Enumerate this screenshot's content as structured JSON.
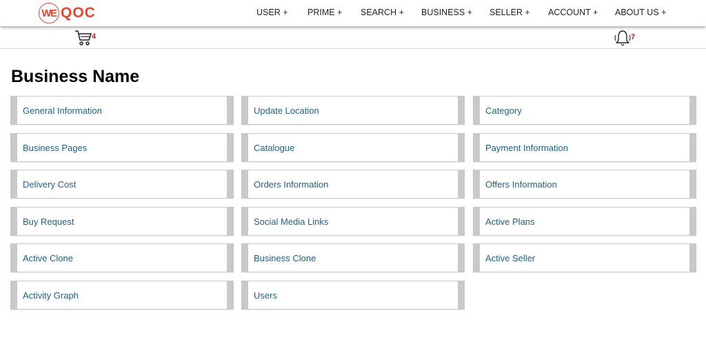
{
  "brand": {
    "logo_mark": "WE",
    "logo_text": "QOC"
  },
  "nav": {
    "items": [
      {
        "id": "user",
        "label": "USER +"
      },
      {
        "id": "prime",
        "label": "PRIME +"
      },
      {
        "id": "search",
        "label": "SEARCH +"
      },
      {
        "id": "business",
        "label": "BUSINESS +"
      },
      {
        "id": "seller",
        "label": "SELLER +"
      },
      {
        "id": "account",
        "label": "ACCOUNT +"
      },
      {
        "id": "about",
        "label": "ABOUT US +"
      }
    ]
  },
  "toolbar": {
    "cart": {
      "icon": "cart-icon",
      "count": "4"
    },
    "notifications": {
      "icon": "bell-icon",
      "count": "7"
    }
  },
  "page": {
    "title": "Business Name"
  },
  "menu": {
    "cards": [
      {
        "label": "General Information"
      },
      {
        "label": "Update Location"
      },
      {
        "label": "Category"
      },
      {
        "label": "Business Pages"
      },
      {
        "label": "Catalogue"
      },
      {
        "label": "Payment Information"
      },
      {
        "label": "Delivery Cost"
      },
      {
        "label": "Orders Information"
      },
      {
        "label": "Offers Information"
      },
      {
        "label": "Buy Request"
      },
      {
        "label": "Social Media Links"
      },
      {
        "label": "Active Plans"
      },
      {
        "label": "Active Clone"
      },
      {
        "label": "Business Clone"
      },
      {
        "label": "Active Seller"
      },
      {
        "label": "Activity Graph"
      },
      {
        "label": "Users"
      }
    ]
  },
  "colors": {
    "brand": "#e8452c",
    "link": "#1f5f86",
    "badge": "#e01010"
  }
}
